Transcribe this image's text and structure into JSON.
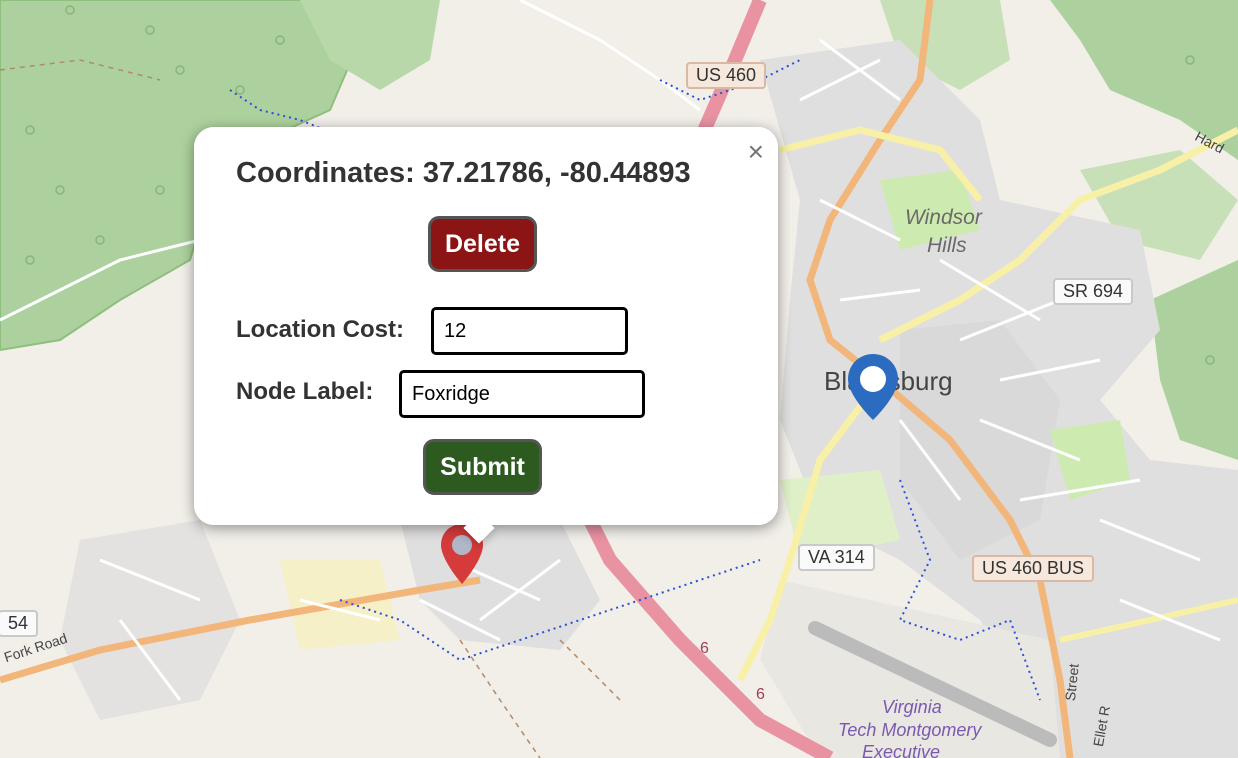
{
  "map": {
    "place_labels": {
      "windsor_hills_line1": "Windsor",
      "windsor_hills_line2": "Hills",
      "blacksburg": "Blacksburg",
      "airport_line1": "Virginia",
      "airport_line2": "Tech Montgomery",
      "airport_line3": "Executive"
    },
    "road_labels": {
      "fork_road": "Fork Road",
      "hard": "Hard",
      "street": "Street",
      "ellet": "Ellet R"
    },
    "route_shields": {
      "us460": "US 460",
      "sr694": "SR 694",
      "va314": "VA 314",
      "us460bus": "US 460 BUS",
      "r54": "54",
      "r6a": "6",
      "r6b": "6"
    },
    "colors": {
      "land": "#f2efe9",
      "forest": "#add19e",
      "interstate": "#e892a2",
      "primary": "#fcd6a4",
      "residential": "#e0dfdf",
      "marker_red": "#d63b3b",
      "marker_blue": "#2b6bc0"
    },
    "markers": [
      {
        "name": "selected-location",
        "color": "red"
      },
      {
        "name": "blacksburg-location",
        "color": "blue"
      }
    ]
  },
  "popup": {
    "title": "Coordinates: 37.21786, -80.44893",
    "close_label": "×",
    "delete_label": "Delete",
    "cost_label": "Location Cost:",
    "cost_value": "12",
    "node_label": "Node Label:",
    "node_value": "Foxridge",
    "submit_label": "Submit"
  }
}
